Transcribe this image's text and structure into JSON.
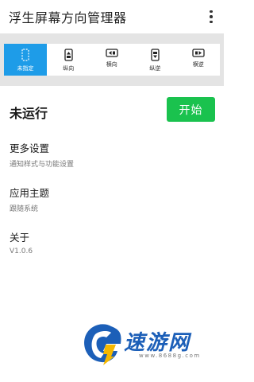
{
  "app": {
    "title": "浮生屏幕方向管理器",
    "menu_icon": "more-vert-icon"
  },
  "orientation_modes": [
    {
      "label": "未指定",
      "icon": "unspecified-icon",
      "selected": true
    },
    {
      "label": "纵向",
      "icon": "portrait-icon",
      "selected": false
    },
    {
      "label": "横向",
      "icon": "landscape-icon",
      "selected": false
    },
    {
      "label": "纵逆",
      "icon": "reverse-portrait-icon",
      "selected": false
    },
    {
      "label": "横逆",
      "icon": "reverse-landscape-icon",
      "selected": false
    }
  ],
  "service": {
    "status": "未运行",
    "start_label": "开始"
  },
  "settings": [
    {
      "title": "更多设置",
      "subtitle": "通知样式与功能设置"
    },
    {
      "title": "应用主题",
      "subtitle": "跟随系统"
    },
    {
      "title": "关于",
      "subtitle": "V1.0.6"
    }
  ],
  "watermark": {
    "text": "速游网",
    "url": "www.8688g.com"
  },
  "colors": {
    "accent": "#1e9ce8",
    "start_button": "#1ac24e",
    "mode_bar_bg": "#e4e4e4",
    "watermark": "#1c5fb8"
  }
}
